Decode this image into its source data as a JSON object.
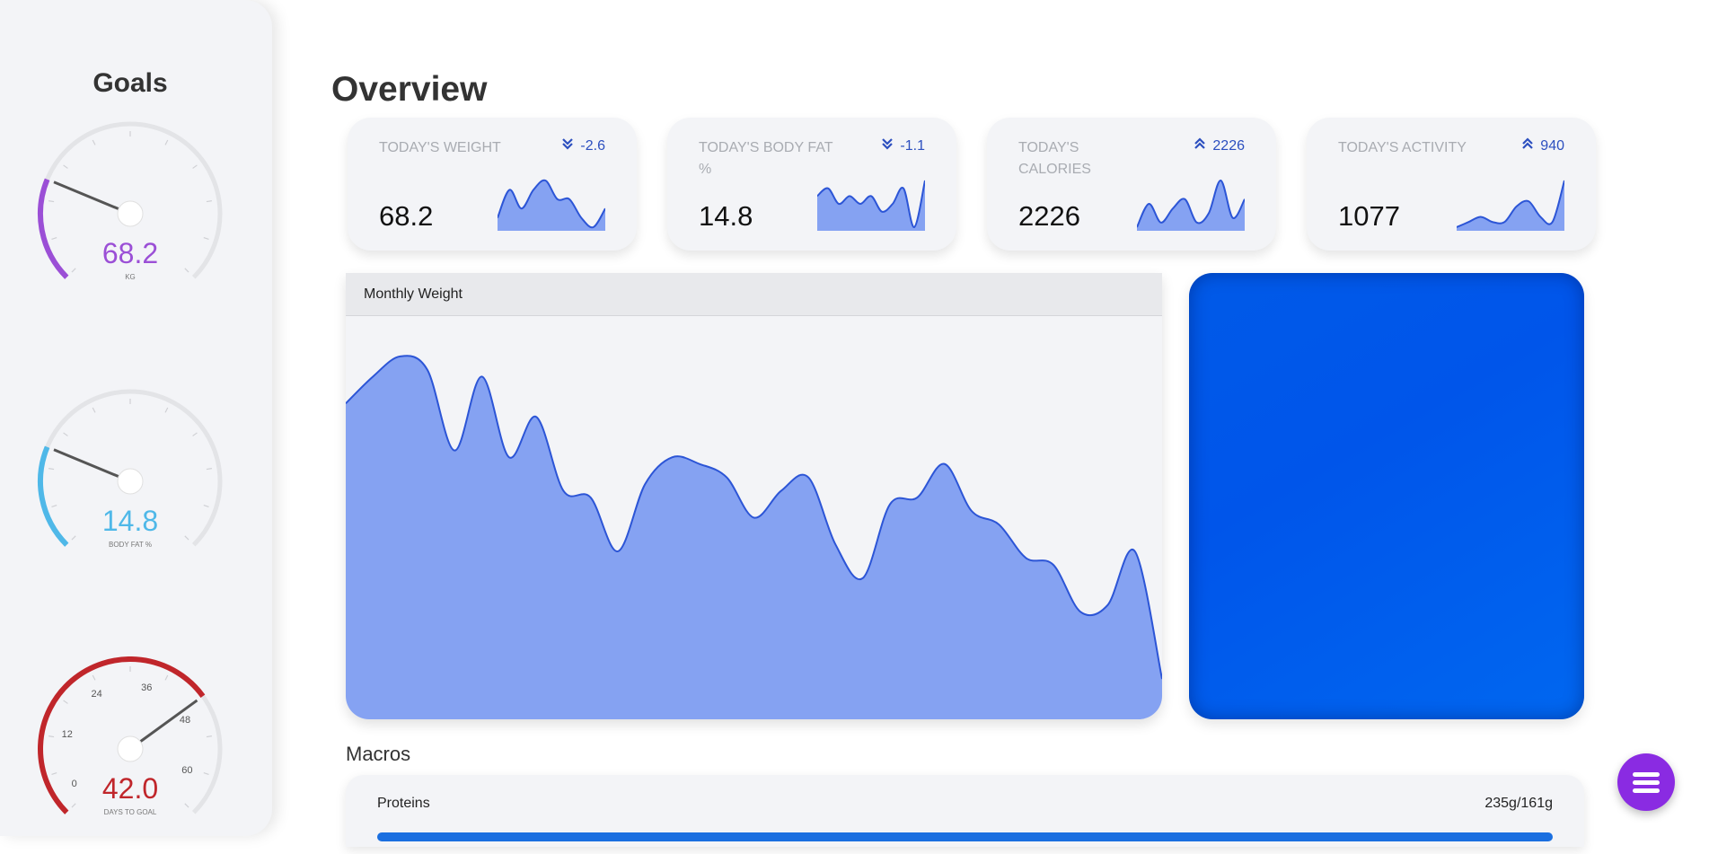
{
  "sidebar": {
    "title": "Goals",
    "gauges": [
      {
        "value": "68.2",
        "unit": "KG",
        "color": "#9b4fd6",
        "progress": 0.25,
        "tick_labels": []
      },
      {
        "value": "14.8",
        "unit": "BODY FAT %",
        "color": "#4fb8e8",
        "progress": 0.25,
        "tick_labels": []
      },
      {
        "value": "42.0",
        "unit": "DAYS TO GOAL",
        "color": "#c0262b",
        "progress": 0.7,
        "scale_max": 60,
        "tick_labels": [
          "0",
          "12",
          "24",
          "36",
          "48",
          "60"
        ]
      }
    ]
  },
  "main": {
    "title": "Overview",
    "cards": [
      {
        "label": "TODAY'S WEIGHT",
        "delta": "-2.6",
        "direction": "down",
        "value": "68.2"
      },
      {
        "label": "TODAY'S BODY FAT %",
        "delta": "-1.1",
        "direction": "down",
        "value": "14.8"
      },
      {
        "label": "TODAY'S CALORIES",
        "delta": "2226",
        "direction": "up",
        "value": "2226"
      },
      {
        "label": "TODAY'S ACTIVITY",
        "delta": "940",
        "direction": "up",
        "value": "1077"
      }
    ],
    "monthly_chart": {
      "title": "Monthly Weight"
    },
    "macros": {
      "title": "Macros",
      "items": [
        {
          "label": "Proteins",
          "amount": "235g/161g",
          "fill_fraction": 1.0,
          "color": "#1a6fe0"
        }
      ]
    }
  },
  "colors": {
    "accent": "#2c4fbf",
    "area_fill": "#85a2f2",
    "area_line": "#2c55d6",
    "fab": "#8a2be2"
  },
  "icons": {
    "down": "double-chevron-down-icon",
    "up": "double-chevron-up-icon",
    "fab": "hamburger-menu-icon"
  },
  "chart_data": [
    {
      "type": "area",
      "title": "Monthly Weight",
      "xlabel": "",
      "ylabel": "",
      "y": [
        68.9,
        69.3,
        69.6,
        69.4,
        68.2,
        69.3,
        68.1,
        68.7,
        67.6,
        67.5,
        66.7,
        67.7,
        68.1,
        68.0,
        67.8,
        67.2,
        67.6,
        67.8,
        66.8,
        66.3,
        67.4,
        67.5,
        68.0,
        67.3,
        67.1,
        66.6,
        66.5,
        65.8,
        65.9,
        66.7,
        64.8
      ]
    },
    {
      "type": "area",
      "title": "",
      "y": [
        4,
        7,
        5,
        7,
        8,
        6,
        6,
        4,
        3,
        5
      ]
    },
    {
      "type": "area",
      "title": "",
      "y": [
        6,
        7,
        5,
        6,
        5,
        6,
        4,
        5,
        7,
        2,
        8
      ]
    },
    {
      "type": "area",
      "title": "",
      "y": [
        0,
        5,
        1,
        4,
        6,
        1,
        3,
        10,
        2,
        6
      ]
    },
    {
      "type": "area",
      "title": "",
      "y": [
        1,
        2,
        3,
        2,
        2,
        5,
        6,
        3,
        2,
        10
      ]
    }
  ]
}
